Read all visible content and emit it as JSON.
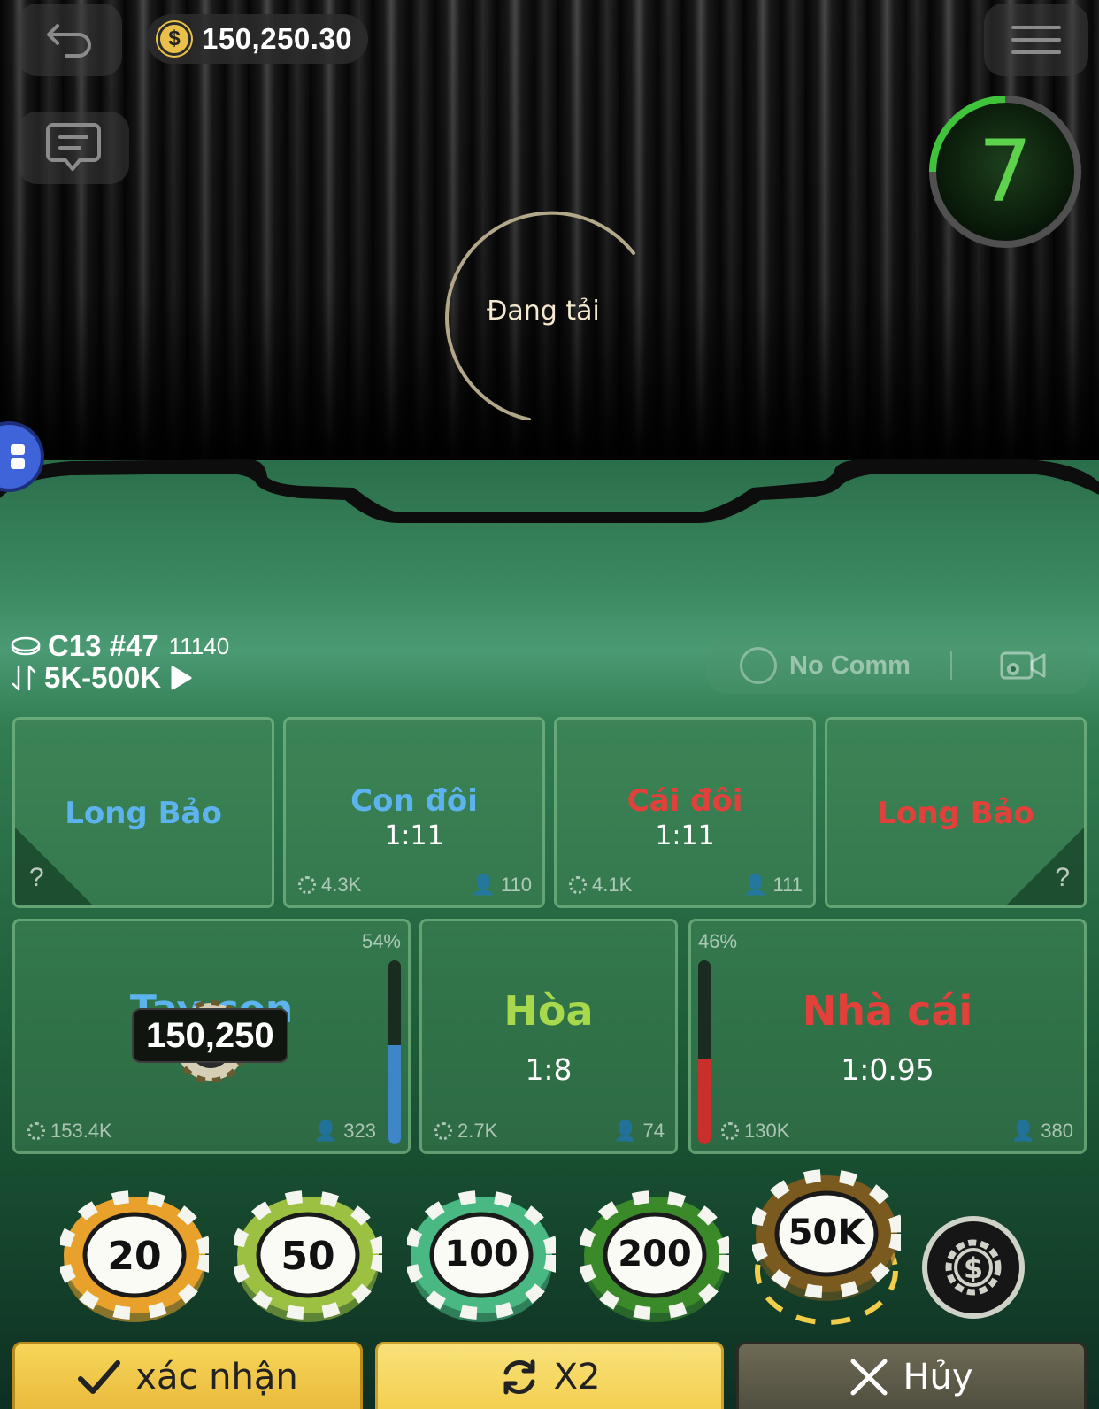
{
  "header": {
    "balance": "150,250.30",
    "timer": "7"
  },
  "loader": {
    "text": "Đang tải"
  },
  "table": {
    "name": "C13 #47",
    "round": "11140",
    "limit": "5K-500K"
  },
  "toggle": {
    "label": "No Comm"
  },
  "bets": {
    "long_bao_player": {
      "title": "Long Bảo",
      "help": "?"
    },
    "player_pair": {
      "title": "Con đôi",
      "odds": "1:11",
      "amount": "4.3K",
      "players": "110"
    },
    "banker_pair": {
      "title": "Cái đôi",
      "odds": "1:11",
      "amount": "4.1K",
      "players": "111"
    },
    "long_bao_banker": {
      "title": "Long Bảo",
      "help": "?"
    },
    "player": {
      "title": "Tay con",
      "percent": "54%",
      "percent_value": 0.54,
      "amount": "153.4K",
      "players": "323",
      "placed_bet": "150,250"
    },
    "tie": {
      "title": "Hòa",
      "odds": "1:8",
      "amount": "2.7K",
      "players": "74"
    },
    "banker": {
      "title": "Nhà cái",
      "odds": "1:0.95",
      "percent": "46%",
      "percent_value": 0.46,
      "amount": "130K",
      "players": "380"
    }
  },
  "chips": [
    {
      "label": "20",
      "color": "#e8a22c"
    },
    {
      "label": "50",
      "color": "#9cc142"
    },
    {
      "label": "100",
      "color": "#49b883"
    },
    {
      "label": "200",
      "color": "#3b8a2a"
    },
    {
      "label": "50K",
      "color": "#7a5a1f",
      "selected": true
    }
  ],
  "colors": {
    "accent_yellow": "#f2cd4a",
    "player_blue": "#3f86c8",
    "banker_red": "#c9302c",
    "timer_green": "#5fd24d"
  },
  "actions": {
    "confirm": "xác nhận",
    "double": "X2",
    "cancel": "Hủy"
  },
  "icons": {
    "back": "back-arrow-icon",
    "menu": "hamburger-menu-icon",
    "chat": "chat-bubble-icon",
    "coin": "dollar-coin-icon",
    "apps": "apps-grid-icon",
    "camera": "camera-settings-icon",
    "settings_chip": "chip-settings-icon"
  }
}
